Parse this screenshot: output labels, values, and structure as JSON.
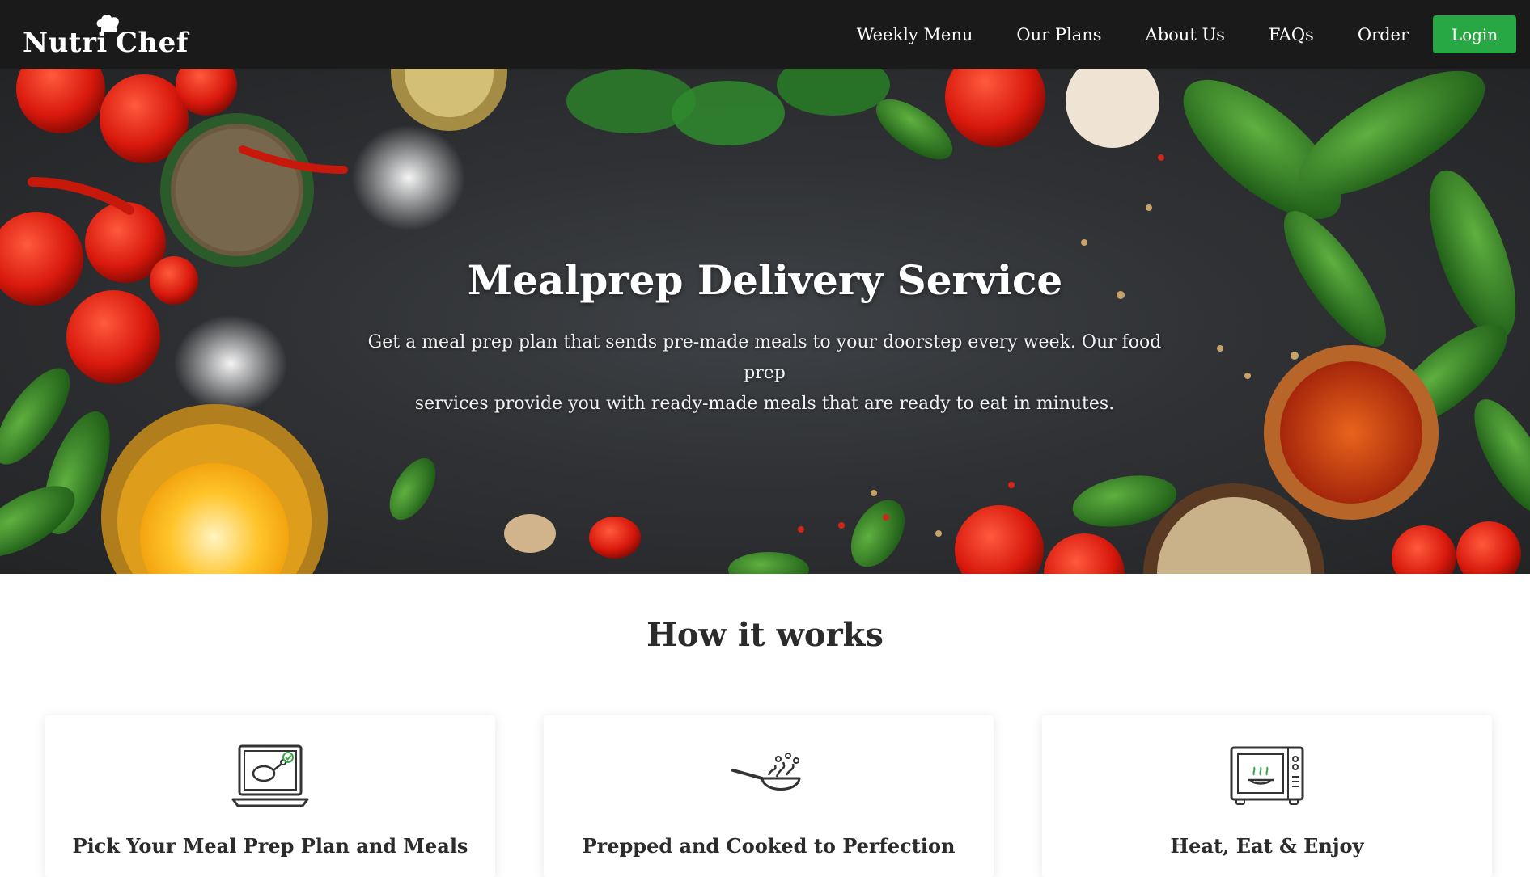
{
  "brand": {
    "name_part1": "Nutri",
    "name_part2": "Chef",
    "icon": "chef-hat-icon"
  },
  "nav": {
    "links": [
      {
        "label": "Weekly Menu"
      },
      {
        "label": "Our Plans"
      },
      {
        "label": "About Us"
      },
      {
        "label": "FAQs"
      },
      {
        "label": "Order"
      }
    ],
    "login_label": "Login",
    "login_color": "#28a745",
    "background_color": "#1a1a1a"
  },
  "hero": {
    "title": "Mealprep Delivery Service",
    "subtitle_line1": "Get a meal prep plan that sends pre-made meals to your doorstep every week. Our food prep",
    "subtitle_line2": "services provide you with ready-made meals that are ready to eat in minutes.",
    "background_image": "ingredients-on-dark-table-photo"
  },
  "how_it_works": {
    "title": "How it works",
    "steps": [
      {
        "title": "Pick Your Meal Prep Plan and Meals",
        "icon": "laptop-meal-icon"
      },
      {
        "title": "Prepped and Cooked to Perfection",
        "icon": "frying-pan-icon"
      },
      {
        "title": "Heat, Eat & Enjoy",
        "icon": "microwave-icon"
      }
    ]
  }
}
